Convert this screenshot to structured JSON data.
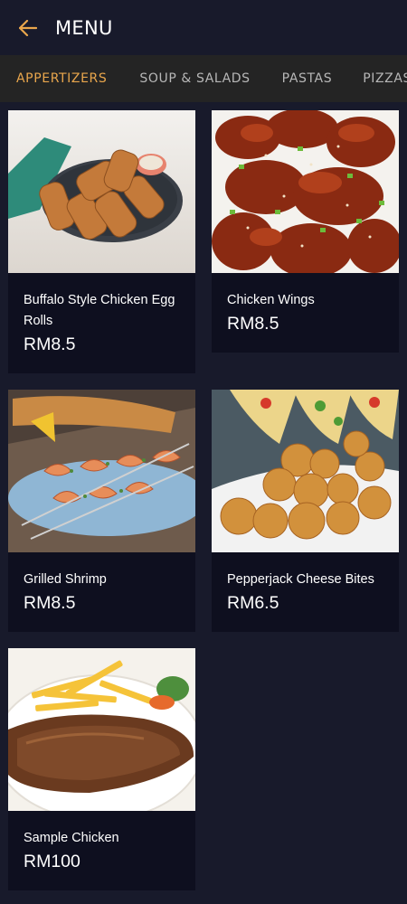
{
  "header": {
    "title": "MENU",
    "back_icon": "arrow-left-icon",
    "accent": "#e9a64c"
  },
  "tabs": [
    {
      "label": "APPERTIZERS",
      "active": true
    },
    {
      "label": "SOUP & SALADS",
      "active": false
    },
    {
      "label": "PASTAS",
      "active": false
    },
    {
      "label": "PIZZAS",
      "active": false
    }
  ],
  "items": [
    {
      "name": "Buffalo Style Chicken Egg Rolls",
      "price": "RM8.5"
    },
    {
      "name": "Chicken Wings",
      "price": "RM8.5"
    },
    {
      "name": "Grilled Shrimp",
      "price": "RM8.5"
    },
    {
      "name": "Pepperjack Cheese Bites",
      "price": "RM6.5"
    },
    {
      "name": "Sample Chicken",
      "price": "RM100"
    }
  ]
}
